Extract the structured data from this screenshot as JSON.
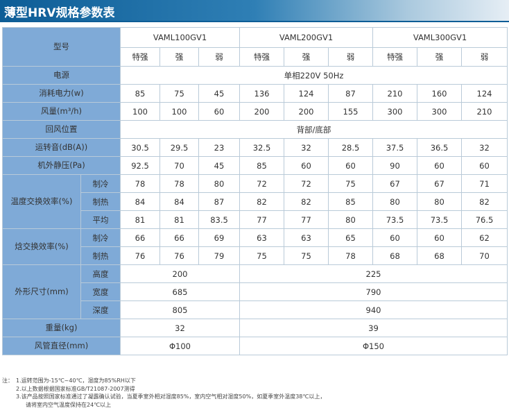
{
  "title": "薄型HRV规格参数表",
  "models": [
    "VAML100GV1",
    "VAML200GV1",
    "VAML300GV1"
  ],
  "levels": [
    "特强",
    "强",
    "弱"
  ],
  "labels": {
    "model": "型号",
    "power_supply": "电源",
    "power_consumption": "消耗电力(w)",
    "air_volume": "风量(m³/h)",
    "return_position": "回风位置",
    "noise": "运转音(dB(A))",
    "static_pressure": "机外静压(Pa)",
    "temp_eff": "温度交换效率(%)",
    "enth_eff": "焓交换效率(%)",
    "dimensions": "外形尺寸(mm)",
    "weight": "重量(kg)",
    "duct": "风管直径(mm)"
  },
  "sub": {
    "cool": "制冷",
    "heat": "制热",
    "avg": "平均",
    "height": "高度",
    "width": "宽度",
    "depth": "深度"
  },
  "values": {
    "power_supply": "单相220V  50Hz",
    "return_position": "背部/底部",
    "power_consumption": [
      "85",
      "75",
      "45",
      "136",
      "124",
      "87",
      "210",
      "160",
      "124"
    ],
    "air_volume": [
      "100",
      "100",
      "60",
      "200",
      "200",
      "155",
      "300",
      "300",
      "210"
    ],
    "noise": [
      "30.5",
      "29.5",
      "23",
      "32.5",
      "32",
      "28.5",
      "37.5",
      "36.5",
      "32"
    ],
    "static_pressure": [
      "92.5",
      "70",
      "45",
      "85",
      "60",
      "60",
      "90",
      "60",
      "60"
    ],
    "temp_cool": [
      "78",
      "78",
      "80",
      "72",
      "72",
      "75",
      "67",
      "67",
      "71"
    ],
    "temp_heat": [
      "84",
      "84",
      "87",
      "82",
      "82",
      "85",
      "80",
      "80",
      "82"
    ],
    "temp_avg": [
      "81",
      "81",
      "83.5",
      "77",
      "77",
      "80",
      "73.5",
      "73.5",
      "76.5"
    ],
    "enth_cool": [
      "66",
      "66",
      "69",
      "63",
      "63",
      "65",
      "60",
      "60",
      "62"
    ],
    "enth_heat": [
      "76",
      "76",
      "79",
      "75",
      "75",
      "78",
      "68",
      "68",
      "70"
    ],
    "height": [
      "200",
      "225"
    ],
    "width": [
      "685",
      "790"
    ],
    "depth": [
      "805",
      "940"
    ],
    "weight": [
      "32",
      "39"
    ],
    "duct": [
      "Φ100",
      "Φ150"
    ]
  },
  "notes": {
    "prefix": "注：",
    "lines": [
      "1.运转范围为-15℃~40℃，湿度为85%RH以下",
      "2.以上数据根据国家标准GB/T21087-2007测得",
      "3.该产品按照国家标准通过了凝露确认试验，当夏季室外相对湿度85%，室内空气相对湿度50%，如夏季室外温度38℃以上，",
      "请将室内空气温度保持在24℃以上"
    ]
  }
}
